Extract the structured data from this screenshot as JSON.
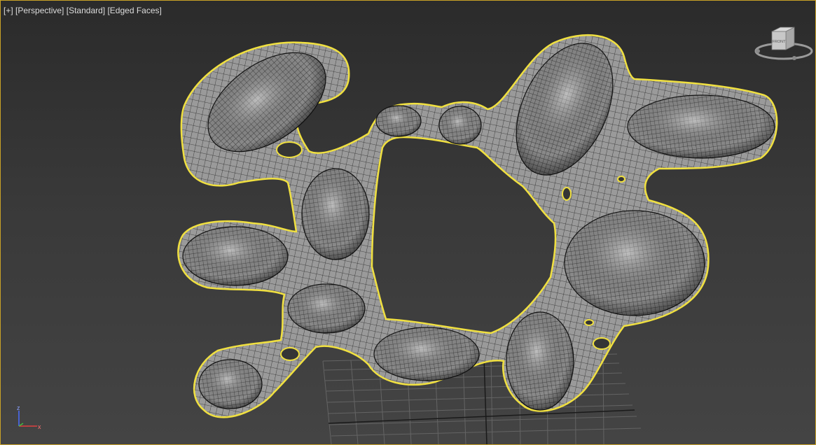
{
  "viewport": {
    "menu_plus": "[+]",
    "view_mode": "[Perspective]",
    "shading": "[Standard]",
    "display": "[Edged Faces]",
    "selected_outline_color": "#f0e040",
    "border_color": "#c9a227"
  },
  "viewcube": {
    "face_label": "FRONT"
  },
  "axis_gizmo": {
    "z_label": "z",
    "x_label": "x"
  }
}
